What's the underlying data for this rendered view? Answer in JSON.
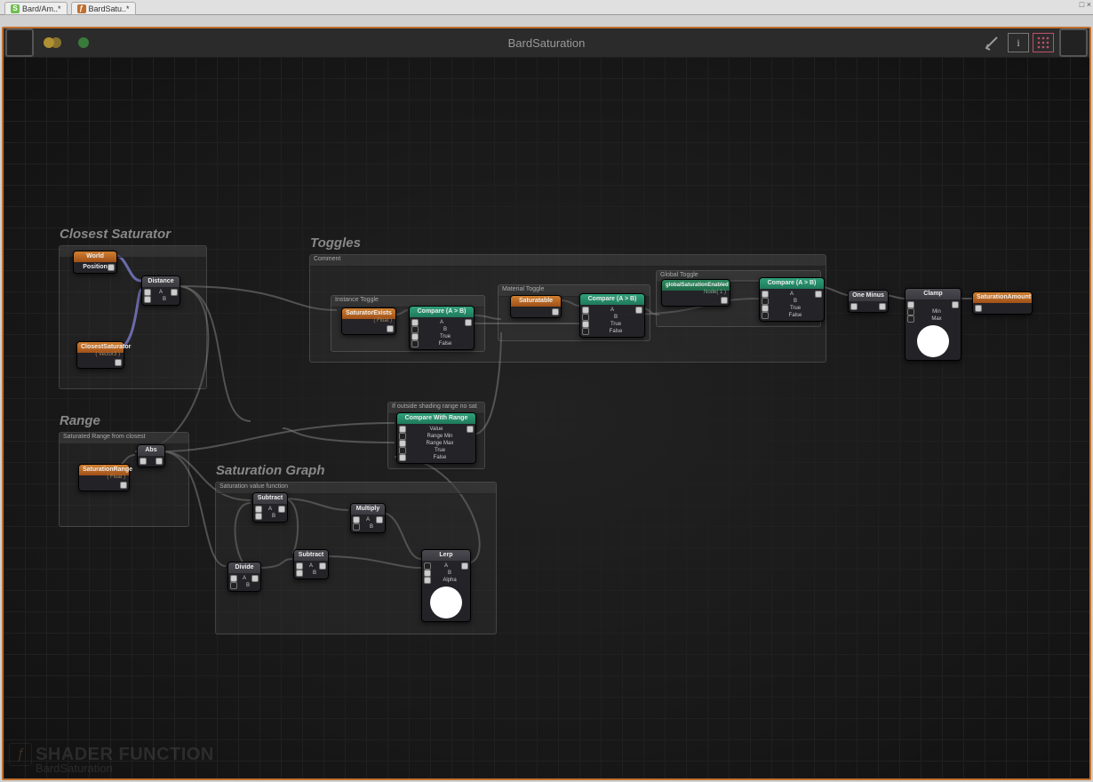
{
  "window": {
    "btns": "□ ×"
  },
  "tabs": [
    {
      "icon": "S",
      "label": "Bard/Am..*"
    },
    {
      "icon": "ƒ",
      "label": "BardSatu..*"
    }
  ],
  "toolbar": {
    "title": "BardSaturation"
  },
  "footer": {
    "line1": "SHADER FUNCTION",
    "line2": "BardSaturation"
  },
  "regions": {
    "closest": {
      "title": "Closest Saturator",
      "hdr": ""
    },
    "range": {
      "title": "Range",
      "hdr": "Saturated Range from closest"
    },
    "toggles": {
      "title": "Toggles",
      "hdr": "Comment"
    },
    "satgraph": {
      "title": "Saturation Graph",
      "hdr": "Saturation value function"
    },
    "outside": {
      "hdr": "If outside shading range no sat"
    },
    "t_instance": {
      "hdr": "Instance Toggle"
    },
    "t_material": {
      "hdr": "Material Toggle"
    },
    "t_global": {
      "hdr": "Global Toggle"
    }
  },
  "nodes": {
    "worldpos": {
      "title": "World Position"
    },
    "closestsat": {
      "title": "ClosestSaturator",
      "sub": "( Vector3 )"
    },
    "distance": {
      "title": "Distance",
      "pins": [
        "A",
        "B"
      ]
    },
    "abs": {
      "title": "Abs"
    },
    "satrange": {
      "title": "SaturationRange",
      "sub": "( Float )"
    },
    "subtract1": {
      "title": "Subtract",
      "pins": [
        "A",
        "B"
      ]
    },
    "multiply": {
      "title": "Multiply",
      "pins": [
        "A",
        "B"
      ]
    },
    "subtract2": {
      "title": "Subtract",
      "pins": [
        "A",
        "B"
      ]
    },
    "divide": {
      "title": "Divide",
      "pins": [
        "A",
        "B"
      ]
    },
    "lerp": {
      "title": "Lerp",
      "pins": [
        "A",
        "B",
        "Alpha"
      ]
    },
    "cmprange": {
      "title": "Compare With Range",
      "pins": [
        "Value",
        "Range Min",
        "Range Max",
        "True",
        "False"
      ]
    },
    "satexists": {
      "title": "SaturatorExists",
      "sub": "( Float )"
    },
    "cmp1": {
      "title": "Compare (A > B)",
      "pins": [
        "A",
        "B",
        "True",
        "False"
      ]
    },
    "saturatable": {
      "title": "Saturatable"
    },
    "cmp2": {
      "title": "Compare (A > B)",
      "pins": [
        "A",
        "B",
        "True",
        "False"
      ]
    },
    "globalsat": {
      "title": "globalSaturationEnabled",
      "sub": "Node( 1 )"
    },
    "cmp3": {
      "title": "Compare (A > B)",
      "pins": [
        "A",
        "B",
        "True",
        "False"
      ]
    },
    "oneminus": {
      "title": "One Minus"
    },
    "clamp": {
      "title": "Clamp",
      "pins": [
        "",
        "Min",
        "Max"
      ]
    },
    "satamount": {
      "title": "SaturationAmount"
    }
  }
}
